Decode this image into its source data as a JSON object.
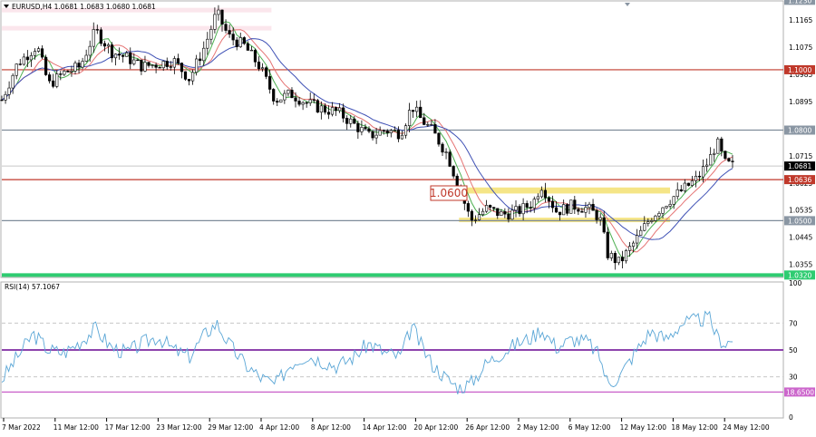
{
  "header": {
    "symbol_info": "EURUSD,H4  1.0681 1.0683 1.0680 1.0681"
  },
  "rsi_header": {
    "label": "RSI(14) 57.1067"
  },
  "colors": {
    "bull": "#000000",
    "bear": "#000000",
    "level_line": "#c0392b",
    "grey_line": "#7f8c9a",
    "zone": "#f4e27a",
    "resistance_zone": "#fbe3ea",
    "ma_fast": "#4caf50",
    "ma_mid": "#e57373",
    "ma_slow": "#3f51b5",
    "rsi": "#5aa6d6",
    "rsi_50": "#8e44ad",
    "rsi_lvl": "#cc66cc",
    "support_bar": "#2ecc71"
  },
  "chart_data": [
    {
      "type": "candlestick",
      "title": "EURUSD,H4",
      "ylim": [
        1.0315,
        1.1225
      ],
      "x_tick_labels": [
        "7 Mar 2022",
        "11 Mar 12:00",
        "17 Mar 12:00",
        "23 Mar 12:00",
        "29 Mar 12:00",
        "4 Apr 12:00",
        "8 Apr 12:00",
        "14 Apr 12:00",
        "20 Apr 12:00",
        "26 Apr 12:00",
        "2 May 12:00",
        "6 May 12:00",
        "12 May 12:00",
        "18 May 12:00",
        "24 May 12:00"
      ],
      "y_tick_labels": [
        "1.1165",
        "1.1075",
        "1.0985",
        "1.0895",
        "1.0715",
        "1.0625",
        "1.0535",
        "1.0445",
        "1.0355"
      ],
      "y_tick_values": [
        1.1165,
        1.1075,
        1.0985,
        1.0895,
        1.0715,
        1.0625,
        1.0535,
        1.0445,
        1.0355
      ],
      "price_tags": [
        {
          "label": "1.1230",
          "value": 1.123,
          "style": "grey"
        },
        {
          "label": "1.1000",
          "value": 1.1,
          "style": "red"
        },
        {
          "label": "1.0800",
          "value": 1.08,
          "style": "grey"
        },
        {
          "label": "1.0681",
          "value": 1.0681,
          "style": "current"
        },
        {
          "label": "1.0636",
          "value": 1.0636,
          "style": "red"
        },
        {
          "label": "1.0500",
          "value": 1.05,
          "style": "grey"
        },
        {
          "label": "1.0320",
          "value": 1.032,
          "style": "green"
        }
      ],
      "horizontal_levels": [
        {
          "value": 1.1,
          "style": "red"
        },
        {
          "value": 1.08,
          "style": "grey"
        },
        {
          "value": 1.0636,
          "style": "red"
        },
        {
          "value": 1.05,
          "style": "grey"
        },
        {
          "value": 1.032,
          "style": "green"
        }
      ],
      "annotation": {
        "text": "1.0600",
        "value": 1.06
      },
      "zones": [
        {
          "from": 1.059,
          "to": 1.061,
          "x_start": 0.59,
          "x_end": 0.855
        },
        {
          "from": 1.0495,
          "to": 1.051,
          "x_start": 0.585,
          "x_end": 0.855
        },
        {
          "from": 1.119,
          "to": 1.1205,
          "x_start": 0.0,
          "x_end": 0.345
        },
        {
          "from": 1.113,
          "to": 1.1145,
          "x_start": 0.0,
          "x_end": 0.345
        }
      ],
      "price_path": [
        [
          0,
          1.09
        ],
        [
          0.02,
          1.102
        ],
        [
          0.045,
          1.108
        ],
        [
          0.06,
          1.095
        ],
        [
          0.08,
          1.099
        ],
        [
          0.1,
          1.101
        ],
        [
          0.12,
          1.113
        ],
        [
          0.14,
          1.106
        ],
        [
          0.16,
          1.104
        ],
        [
          0.18,
          1.101
        ],
        [
          0.2,
          1.102
        ],
        [
          0.22,
          1.103
        ],
        [
          0.24,
          1.097
        ],
        [
          0.26,
          1.108
        ],
        [
          0.275,
          1.119
        ],
        [
          0.29,
          1.111
        ],
        [
          0.31,
          1.108
        ],
        [
          0.33,
          1.101
        ],
        [
          0.35,
          1.09
        ],
        [
          0.37,
          1.092
        ],
        [
          0.39,
          1.089
        ],
        [
          0.41,
          1.087
        ],
        [
          0.43,
          1.086
        ],
        [
          0.45,
          1.082
        ],
        [
          0.47,
          1.078
        ],
        [
          0.49,
          1.08
        ],
        [
          0.51,
          1.079
        ],
        [
          0.525,
          1.088
        ],
        [
          0.535,
          1.084
        ],
        [
          0.55,
          1.08
        ],
        [
          0.57,
          1.072
        ],
        [
          0.585,
          1.061
        ],
        [
          0.6,
          1.05
        ],
        [
          0.62,
          1.054
        ],
        [
          0.64,
          1.052
        ],
        [
          0.66,
          1.053
        ],
        [
          0.68,
          1.056
        ],
        [
          0.69,
          1.062
        ],
        [
          0.71,
          1.053
        ],
        [
          0.73,
          1.055
        ],
        [
          0.75,
          1.054
        ],
        [
          0.765,
          1.051
        ],
        [
          0.775,
          1.039
        ],
        [
          0.79,
          1.036
        ],
        [
          0.81,
          1.043
        ],
        [
          0.83,
          1.051
        ],
        [
          0.85,
          1.056
        ],
        [
          0.87,
          1.06
        ],
        [
          0.89,
          1.064
        ],
        [
          0.905,
          1.07
        ],
        [
          0.915,
          1.076
        ],
        [
          0.925,
          1.069
        ],
        [
          0.935,
          1.0681
        ]
      ],
      "rsi": {
        "label": "RSI(14) 57.1067",
        "ylim": [
          0,
          100
        ],
        "levels": [
          70,
          50,
          30,
          18.65
        ],
        "y_tick_labels": [
          "100",
          "70",
          "50",
          "30",
          "0"
        ],
        "level_tag": "18.6500",
        "path": [
          [
            0,
            28
          ],
          [
            0.02,
            45
          ],
          [
            0.04,
            62
          ],
          [
            0.06,
            50
          ],
          [
            0.08,
            48
          ],
          [
            0.1,
            56
          ],
          [
            0.12,
            66
          ],
          [
            0.14,
            52
          ],
          [
            0.16,
            48
          ],
          [
            0.18,
            55
          ],
          [
            0.2,
            60
          ],
          [
            0.22,
            50
          ],
          [
            0.24,
            45
          ],
          [
            0.26,
            62
          ],
          [
            0.275,
            70
          ],
          [
            0.29,
            55
          ],
          [
            0.31,
            40
          ],
          [
            0.33,
            30
          ],
          [
            0.35,
            24
          ],
          [
            0.37,
            40
          ],
          [
            0.39,
            46
          ],
          [
            0.41,
            42
          ],
          [
            0.43,
            38
          ],
          [
            0.45,
            45
          ],
          [
            0.47,
            55
          ],
          [
            0.49,
            48
          ],
          [
            0.51,
            45
          ],
          [
            0.525,
            68
          ],
          [
            0.535,
            55
          ],
          [
            0.55,
            40
          ],
          [
            0.57,
            28
          ],
          [
            0.585,
            22
          ],
          [
            0.6,
            25
          ],
          [
            0.62,
            40
          ],
          [
            0.64,
            48
          ],
          [
            0.66,
            55
          ],
          [
            0.68,
            60
          ],
          [
            0.69,
            66
          ],
          [
            0.71,
            52
          ],
          [
            0.73,
            58
          ],
          [
            0.75,
            56
          ],
          [
            0.765,
            45
          ],
          [
            0.775,
            25
          ],
          [
            0.79,
            30
          ],
          [
            0.81,
            48
          ],
          [
            0.83,
            64
          ],
          [
            0.85,
            58
          ],
          [
            0.87,
            70
          ],
          [
            0.89,
            72
          ],
          [
            0.905,
            74
          ],
          [
            0.915,
            60
          ],
          [
            0.925,
            55
          ],
          [
            0.935,
            57
          ]
        ]
      }
    }
  ]
}
